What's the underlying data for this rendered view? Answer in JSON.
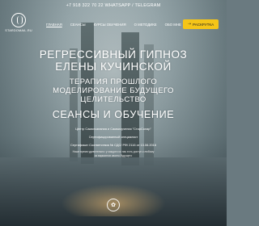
{
  "topbar": {
    "contact": "+7 918 322 70 22 WHATSAPP / TELEGRAM"
  },
  "logo": {
    "text": "STARDOMAIL.RU"
  },
  "nav": {
    "items": [
      {
        "label": "ГЛАВНАЯ",
        "active": true
      },
      {
        "label": "СЕАНСЫ"
      },
      {
        "label": "КУРСЫ ОБУЧЕНИЯ"
      },
      {
        "label": "О МЕТОДИКЕ"
      },
      {
        "label": "ОБО МНЕ"
      },
      {
        "label": "СТАТЬИ"
      }
    ],
    "cta": {
      "label": "РАСКРУТКА",
      "icon": "arrow-icon"
    }
  },
  "hero": {
    "title_line1": "РЕГРЕССИВНЫЙ ГИПНОЗ",
    "title_line2": "ЕЛЕНЫ КУЧИНСКОЙ",
    "subtitle_line1": "ТЕРАПИЯ ПРОШЛОГО",
    "subtitle_line2": "МОДЕЛИРОВАНИЕ БУДУЩЕГО",
    "subtitle_line3": "ЦЕЛИТЕЛЬСТВО",
    "section_title": "СЕАНСЫ И ОБУЧЕНИЕ",
    "info_line1": "Центр Самопознания и Самоизучения \"СтарСолар\"",
    "info_line2": "Сертифицированный специалист",
    "info_line3": "Сертификат Соответствия № СДС/ РФ/ 2116 от 13.06.2016",
    "note_line1": "Наше время удивительно: у каждого из нас есть доступ к любому",
    "note_line2": "из вариантов своего будущего"
  },
  "colors": {
    "accent": "#f5c518"
  }
}
